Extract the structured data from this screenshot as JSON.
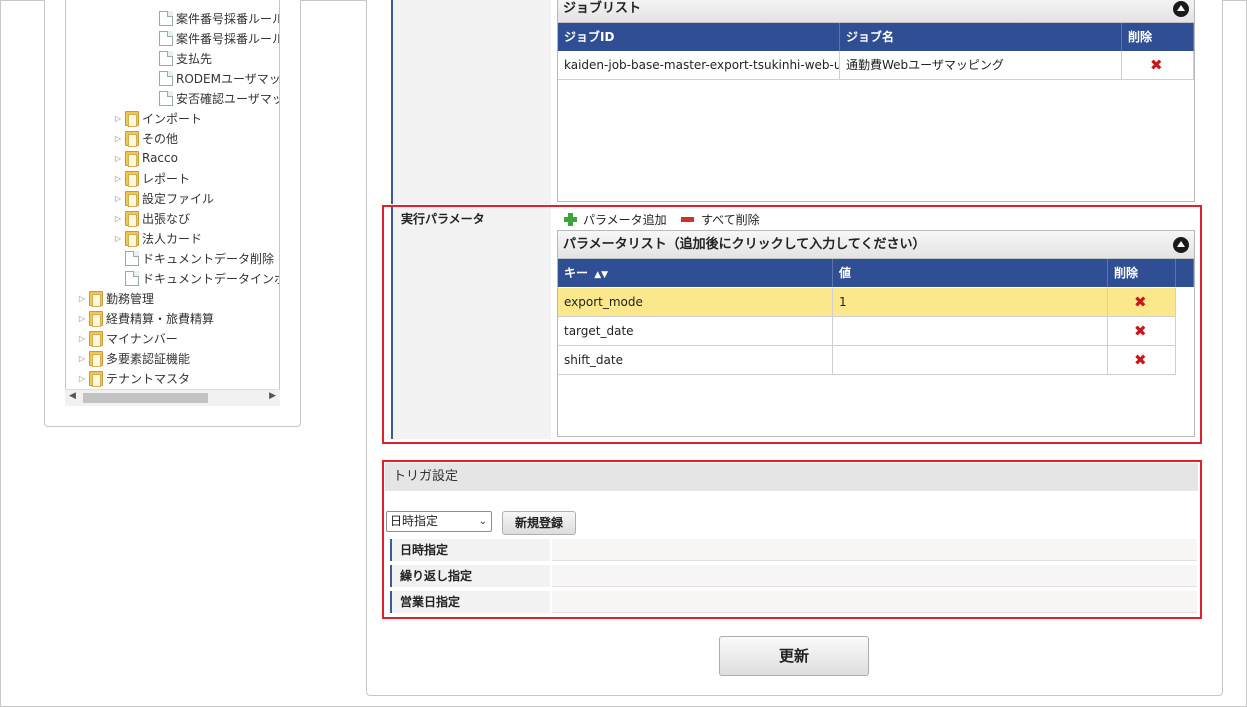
{
  "tree": {
    "items": [
      {
        "label": "案件番号採番ルール",
        "type": "doc",
        "arrow": ""
      },
      {
        "label": "案件番号採番ルール",
        "type": "doc",
        "arrow": ""
      },
      {
        "label": "支払先",
        "type": "doc",
        "arrow": ""
      },
      {
        "label": "RODEMユーザマッピ",
        "type": "doc",
        "arrow": ""
      },
      {
        "label": "安否確認ユーザマッピ",
        "type": "doc",
        "arrow": ""
      },
      {
        "label": "インポート",
        "type": "folder",
        "arrow": "▷"
      },
      {
        "label": "その他",
        "type": "folder",
        "arrow": "▷"
      },
      {
        "label": "Racco",
        "type": "folder",
        "arrow": "▷"
      },
      {
        "label": "レポート",
        "type": "folder",
        "arrow": "▷"
      },
      {
        "label": "設定ファイル",
        "type": "folder",
        "arrow": "▷"
      },
      {
        "label": "出張なび",
        "type": "folder",
        "arrow": "▷"
      },
      {
        "label": "法人カード",
        "type": "folder",
        "arrow": "▷"
      },
      {
        "label": "ドキュメントデータ削除",
        "type": "doc",
        "arrow": ""
      },
      {
        "label": "ドキュメントデータインポー",
        "type": "doc",
        "arrow": ""
      },
      {
        "label": "勤務管理",
        "type": "folder",
        "arrow": "▷"
      },
      {
        "label": "経費精算・旅費精算",
        "type": "folder",
        "arrow": "▷"
      },
      {
        "label": "マイナンバー",
        "type": "folder",
        "arrow": "▷"
      },
      {
        "label": "多要素認証機能",
        "type": "folder",
        "arrow": "▷"
      },
      {
        "label": "テナントマスタ",
        "type": "folder",
        "arrow": "▷"
      }
    ]
  },
  "job_list": {
    "title": "ジョブリスト",
    "headers": {
      "id": "ジョブID",
      "name": "ジョブ名",
      "delete": "削除"
    },
    "rows": [
      {
        "id": "kaiden-job-base-master-export-tsukinhi-web-user",
        "name": "通勤費Webユーザマッピング"
      }
    ]
  },
  "params": {
    "section_label": "実行パラメータ",
    "add_label": "パラメータ追加",
    "clear_label": "すべて削除",
    "list_title": "パラメータリスト（追加後にクリックして入力してください）",
    "headers": {
      "key": "キー",
      "value": "値",
      "delete": "削除"
    },
    "rows": [
      {
        "key": "export_mode",
        "value": "1"
      },
      {
        "key": "target_date",
        "value": ""
      },
      {
        "key": "shift_date",
        "value": ""
      }
    ]
  },
  "trigger": {
    "title": "トリガ設定",
    "select_value": "日時指定",
    "new_button": "新規登録",
    "rows": [
      "日時指定",
      "繰り返し指定",
      "営業日指定"
    ]
  },
  "update_button": "更新",
  "delete_glyph": "✖",
  "colors": {
    "header_blue": "#304e93",
    "selected_row": "#fbe88c",
    "highlight_red": "#e0202a",
    "delete_red": "#c8171b"
  }
}
